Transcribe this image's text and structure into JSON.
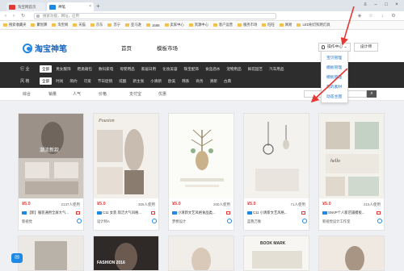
{
  "browser": {
    "tabs": [
      {
        "label": "淘宝网首页"
      },
      {
        "label": "神笔"
      }
    ],
    "url_placeholder": "搜索功能，网址，应用",
    "bookmarks": [
      "搜索收藏夹",
      "聚划算",
      "淘宝网",
      "天猫",
      "京东",
      "苏宁",
      "亚马逊",
      "1688",
      "卖家中心",
      "资源中心",
      "客户运营",
      "服务市场",
      "旺旺",
      "网易",
      "LED射灯照明灯具"
    ]
  },
  "header": {
    "logo_text": "淘宝神笔",
    "nav": [
      "首页",
      "模板市场"
    ],
    "user_menu": "操作中心",
    "design_button": "设计师"
  },
  "dropdown": {
    "items": [
      "宝贝管理",
      "模板管理",
      "模板管理",
      "我的素材",
      "动态主图"
    ]
  },
  "filters": {
    "row1_label": "行 业",
    "row1": [
      "全部",
      "男女服饰",
      "鞋类箱包",
      "数码家电",
      "母婴用品",
      "家居日用",
      "化妆美容",
      "珠宝配饰",
      "食品酒水",
      "宠物用品",
      "鲜花园艺",
      "汽车用品"
    ],
    "row2_label": "风 格",
    "row2": [
      "全部",
      "时尚",
      "简约",
      "可爱",
      "节日促销",
      "炫酷",
      "新主张",
      "小清新",
      "欧美",
      "韩系",
      "商务",
      "清新",
      "古典"
    ]
  },
  "sortbar": {
    "items": [
      "综合",
      "销量",
      "人气",
      "价格",
      "支付宝",
      "优惠"
    ]
  },
  "cards": [
    {
      "price": "¥5.0",
      "usage": "2137人使用",
      "title": "【新】服装通用全屏大气...",
      "footer": "新视觉",
      "thumb_text": "潮流新款"
    },
    {
      "price": "¥5.0",
      "usage": "305人使用",
      "title": "C11 女装 简洁大气风格...",
      "footer": "设计师A",
      "thumb_text": "Pousion"
    },
    {
      "price": "¥5.0",
      "usage": "200人使用",
      "title": "小清新文艺风格食品类...",
      "footer": "梦想设计",
      "thumb_text": ""
    },
    {
      "price": "¥5.0",
      "usage": "71人使用",
      "title": "C11 小清新文艺风格...",
      "footer": "蓝我万象",
      "thumb_text": ""
    },
    {
      "price": "¥5.0",
      "usage": "215人使用",
      "title": "SNVP个人新店铺模板...",
      "footer": "新视觉设计工作室",
      "thumb_text": "hello"
    }
  ],
  "second_row": [
    {
      "thumb_text": "FASHION 2016"
    },
    {
      "thumb_text": ""
    },
    {
      "thumb_text": ""
    },
    {
      "thumb_text": "BOOK MARK"
    },
    {
      "thumb_text": ""
    }
  ],
  "colors": {
    "brand": "#1565c0",
    "price": "#e53935",
    "link": "#1e73c8",
    "filter_bg": "#2d2d2d",
    "annotation": "#e53935"
  }
}
